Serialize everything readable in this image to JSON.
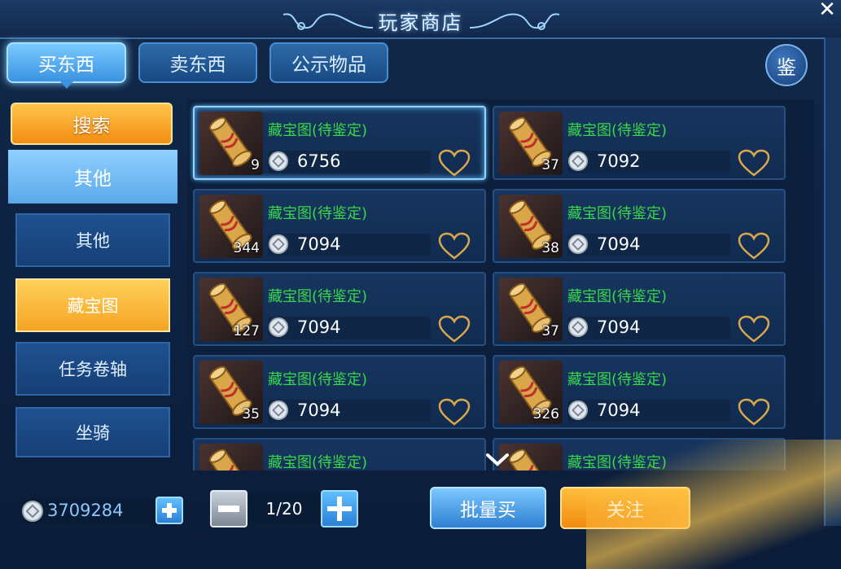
{
  "window": {
    "title": "玩家商店",
    "close_glyph": "✕"
  },
  "tabs": [
    {
      "label": "买东西",
      "active": true
    },
    {
      "label": "卖东西",
      "active": false
    },
    {
      "label": "公示物品",
      "active": false
    }
  ],
  "identify_button": {
    "label": "鉴"
  },
  "sidebar": {
    "search_label": "搜索",
    "category_label": "其他",
    "sub_items": [
      {
        "label": "其他",
        "selected": false
      },
      {
        "label": "藏宝图",
        "selected": true
      },
      {
        "label": "任务卷轴",
        "selected": false
      },
      {
        "label": "坐骑",
        "selected": false
      }
    ]
  },
  "items": [
    {
      "name": "藏宝图(待鉴定)",
      "count": "9",
      "price": "6756",
      "selected": true
    },
    {
      "name": "藏宝图(待鉴定)",
      "count": "37",
      "price": "7092",
      "selected": false
    },
    {
      "name": "藏宝图(待鉴定)",
      "count": "344",
      "price": "7094",
      "selected": false
    },
    {
      "name": "藏宝图(待鉴定)",
      "count": "38",
      "price": "7094",
      "selected": false
    },
    {
      "name": "藏宝图(待鉴定)",
      "count": "127",
      "price": "7094",
      "selected": false
    },
    {
      "name": "藏宝图(待鉴定)",
      "count": "37",
      "price": "7094",
      "selected": false
    },
    {
      "name": "藏宝图(待鉴定)",
      "count": "35",
      "price": "7094",
      "selected": false
    },
    {
      "name": "藏宝图(待鉴定)",
      "count": "326",
      "price": "7094",
      "selected": false
    },
    {
      "name": "藏宝图(待鉴定)",
      "count": "",
      "price": "",
      "selected": false
    },
    {
      "name": "藏宝图(待鉴定)",
      "count": "",
      "price": "",
      "selected": false
    }
  ],
  "footer": {
    "balance": "3709284",
    "page": "1/20",
    "bulk_buy_label": "批量买",
    "follow_label": "关注"
  },
  "colors": {
    "item_name": "#37d84a",
    "accent_blue": "#5aa8ea",
    "accent_orange": "#f5a423"
  }
}
